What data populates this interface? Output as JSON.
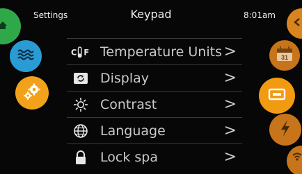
{
  "status": {
    "left_label": "Settings",
    "title": "Keypad",
    "time": "8:01am"
  },
  "menu": {
    "items": [
      {
        "label": "Temperature Units",
        "icon": "temperature-units-icon",
        "icon_text": "C°F"
      },
      {
        "label": "Display",
        "icon": "display-icon"
      },
      {
        "label": "Contrast",
        "icon": "contrast-sun-icon"
      },
      {
        "label": "Language",
        "icon": "language-globe-icon"
      },
      {
        "label": "Lock spa",
        "icon": "lock-icon"
      }
    ],
    "chevron": ">"
  },
  "side_buttons": {
    "left": [
      {
        "name": "home-button",
        "icon": "home-icon",
        "color": "#2fa84a"
      },
      {
        "name": "water-button",
        "icon": "water-waves-icon",
        "color": "#2a9bd4"
      },
      {
        "name": "settings-button",
        "icon": "gears-icon",
        "color": "#f2a21a"
      }
    ],
    "right": [
      {
        "name": "back-button",
        "icon": "back-arrow-icon",
        "color": "#d9841e"
      },
      {
        "name": "calendar-button",
        "icon": "calendar-icon",
        "color": "#c8741a",
        "text": "31"
      },
      {
        "name": "keypad-button",
        "icon": "keypad-icon",
        "color": "#f29a12"
      },
      {
        "name": "power-button",
        "icon": "lightning-icon",
        "color": "#c8741a"
      },
      {
        "name": "wifi-button",
        "icon": "wifi-icon",
        "color": "#c8741a"
      }
    ]
  },
  "colors": {
    "background": "#070707",
    "text": "#c9c9c9",
    "accent_orange": "#f2a21a",
    "divider": "#3b3b3b"
  }
}
